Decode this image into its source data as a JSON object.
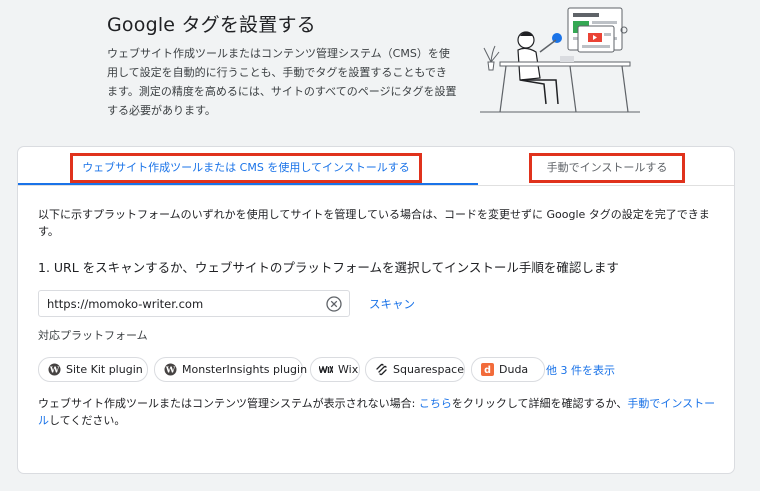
{
  "header": {
    "title": "Google タグを設置する",
    "intro": "ウェブサイト作成ツールまたはコンテンツ管理システム（CMS）を使用して設定を自動的に行うことも、手動でタグを設置することもできます。測定の精度を高めるには、サイトのすべてのページにタグを設置する必要があります。"
  },
  "tabs": [
    {
      "label": "ウェブサイト作成ツールまたは CMS を使用してインストールする",
      "selected": true
    },
    {
      "label": "手動でインストールする",
      "selected": false
    }
  ],
  "content": {
    "description": "以下に示すプラットフォームのいずれかを使用してサイトを管理している場合は、コードを変更せずに Google タグの設定を完了できます。",
    "step_title": "1. URL をスキャンするか、ウェブサイトのプラットフォームを選択してインストール手順を確認します",
    "url_value": "https://momoko-writer.com",
    "scan_label": "スキャン",
    "platforms_label": "対応プラットフォーム",
    "platforms": [
      {
        "label": "Site Kit plugin",
        "icon": "wordpress-icon"
      },
      {
        "label": "MonsterInsights plugin",
        "icon": "wordpress-icon"
      },
      {
        "label": "Wix",
        "icon": "wix-logo-icon"
      },
      {
        "label": "Squarespace",
        "icon": "squarespace-icon"
      },
      {
        "label": "Duda",
        "icon": "duda-icon"
      }
    ],
    "more_label": "他 3 件を表示",
    "footer_prefix": "ウェブサイト作成ツールまたはコンテンツ管理システムが表示されない場合: ",
    "footer_link1": "こちら",
    "footer_middle": "をクリックして詳細を確認するか、",
    "footer_link2": "手動でインストール",
    "footer_suffix": "してください。"
  },
  "colors": {
    "accent": "#1a73e8",
    "highlight_border": "#e0321c",
    "duda": "#f26b3a"
  }
}
